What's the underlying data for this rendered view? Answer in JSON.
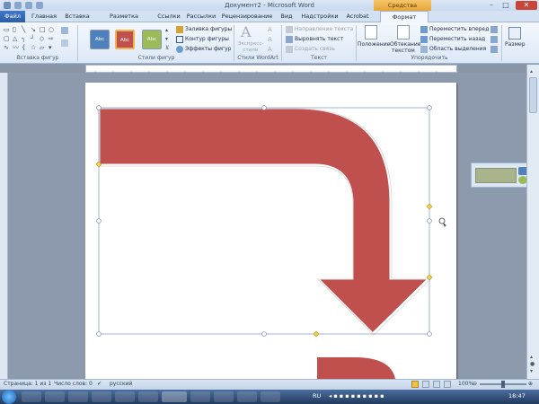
{
  "window": {
    "title": "Документ2 - Microsoft Word",
    "context_tab_group": "Средства рисования",
    "controls": {
      "minimize": "–",
      "maximize": "□",
      "close": "✕"
    }
  },
  "ribbon_tabs": [
    "Главная",
    "Вставка",
    "Разметка страницы",
    "Ссылки",
    "Рассылки",
    "Рецензирование",
    "Вид",
    "Надстройки",
    "Acrobat"
  ],
  "file_tab": "Файл",
  "format_tab": "Формат",
  "groups": {
    "insert_shapes": "Вставка фигур",
    "shape_styles": "Стили фигур",
    "wordart_styles": "Стили WordArt",
    "text": "Текст",
    "arrange": "Упорядочить"
  },
  "shape_styles": {
    "samples": [
      {
        "label": "Abc",
        "color": "#4f81bd"
      },
      {
        "label": "Abc",
        "color": "#c0504d"
      },
      {
        "label": "Abc",
        "color": "#9bbb59"
      }
    ],
    "fill": "Заливка фигуры",
    "outline": "Контур фигуры",
    "effects": "Эффекты фигур"
  },
  "wordart": {
    "express_styles": "Экспресс-стили"
  },
  "text_group": {
    "direction": "Направление текста",
    "align": "Выровнять текст",
    "create_link": "Создать связь"
  },
  "arrange": {
    "position": "Положение",
    "wrap_line1": "Обтекание",
    "wrap_line2": "текстом",
    "bring_forward": "Переместить вперед",
    "send_backward": "Переместить назад",
    "selection_pane": "Область выделения",
    "size": "Размер"
  },
  "document": {
    "arrow_fill": "#c0504d",
    "arrow_outline": "#ffffff"
  },
  "status": {
    "page": "Страница: 1 из 1",
    "words": "Число слов: 0",
    "language": "русский",
    "zoom": "100%",
    "zoom_value": 100
  },
  "taskbar": {
    "lang": "RU",
    "time": "18:47"
  }
}
